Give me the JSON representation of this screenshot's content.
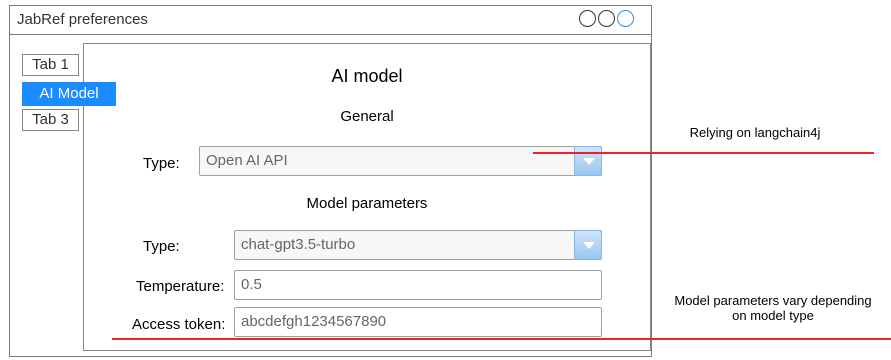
{
  "window": {
    "title": "JabRef preferences"
  },
  "tabs": [
    {
      "label": "Tab 1",
      "active": false
    },
    {
      "label": "AI Model",
      "active": true
    },
    {
      "label": "Tab 3",
      "active": false
    }
  ],
  "panel": {
    "title": "AI model",
    "general": {
      "heading": "General",
      "type_label": "Type:",
      "type_value": "Open AI API"
    },
    "model_params": {
      "heading": "Model parameters",
      "type_label": "Type:",
      "type_value": "chat-gpt3.5-turbo",
      "temperature_label": "Temperature:",
      "temperature_value": "0.5",
      "token_label": "Access token:",
      "token_value": "abcdefgh1234567890"
    }
  },
  "annotations": {
    "langchain": "Relying on langchain4j",
    "params_line1": "Model parameters vary depending",
    "params_line2": "on model type"
  },
  "colors": {
    "accent": "#1a8cff",
    "annotation_line": "#e8252a"
  }
}
